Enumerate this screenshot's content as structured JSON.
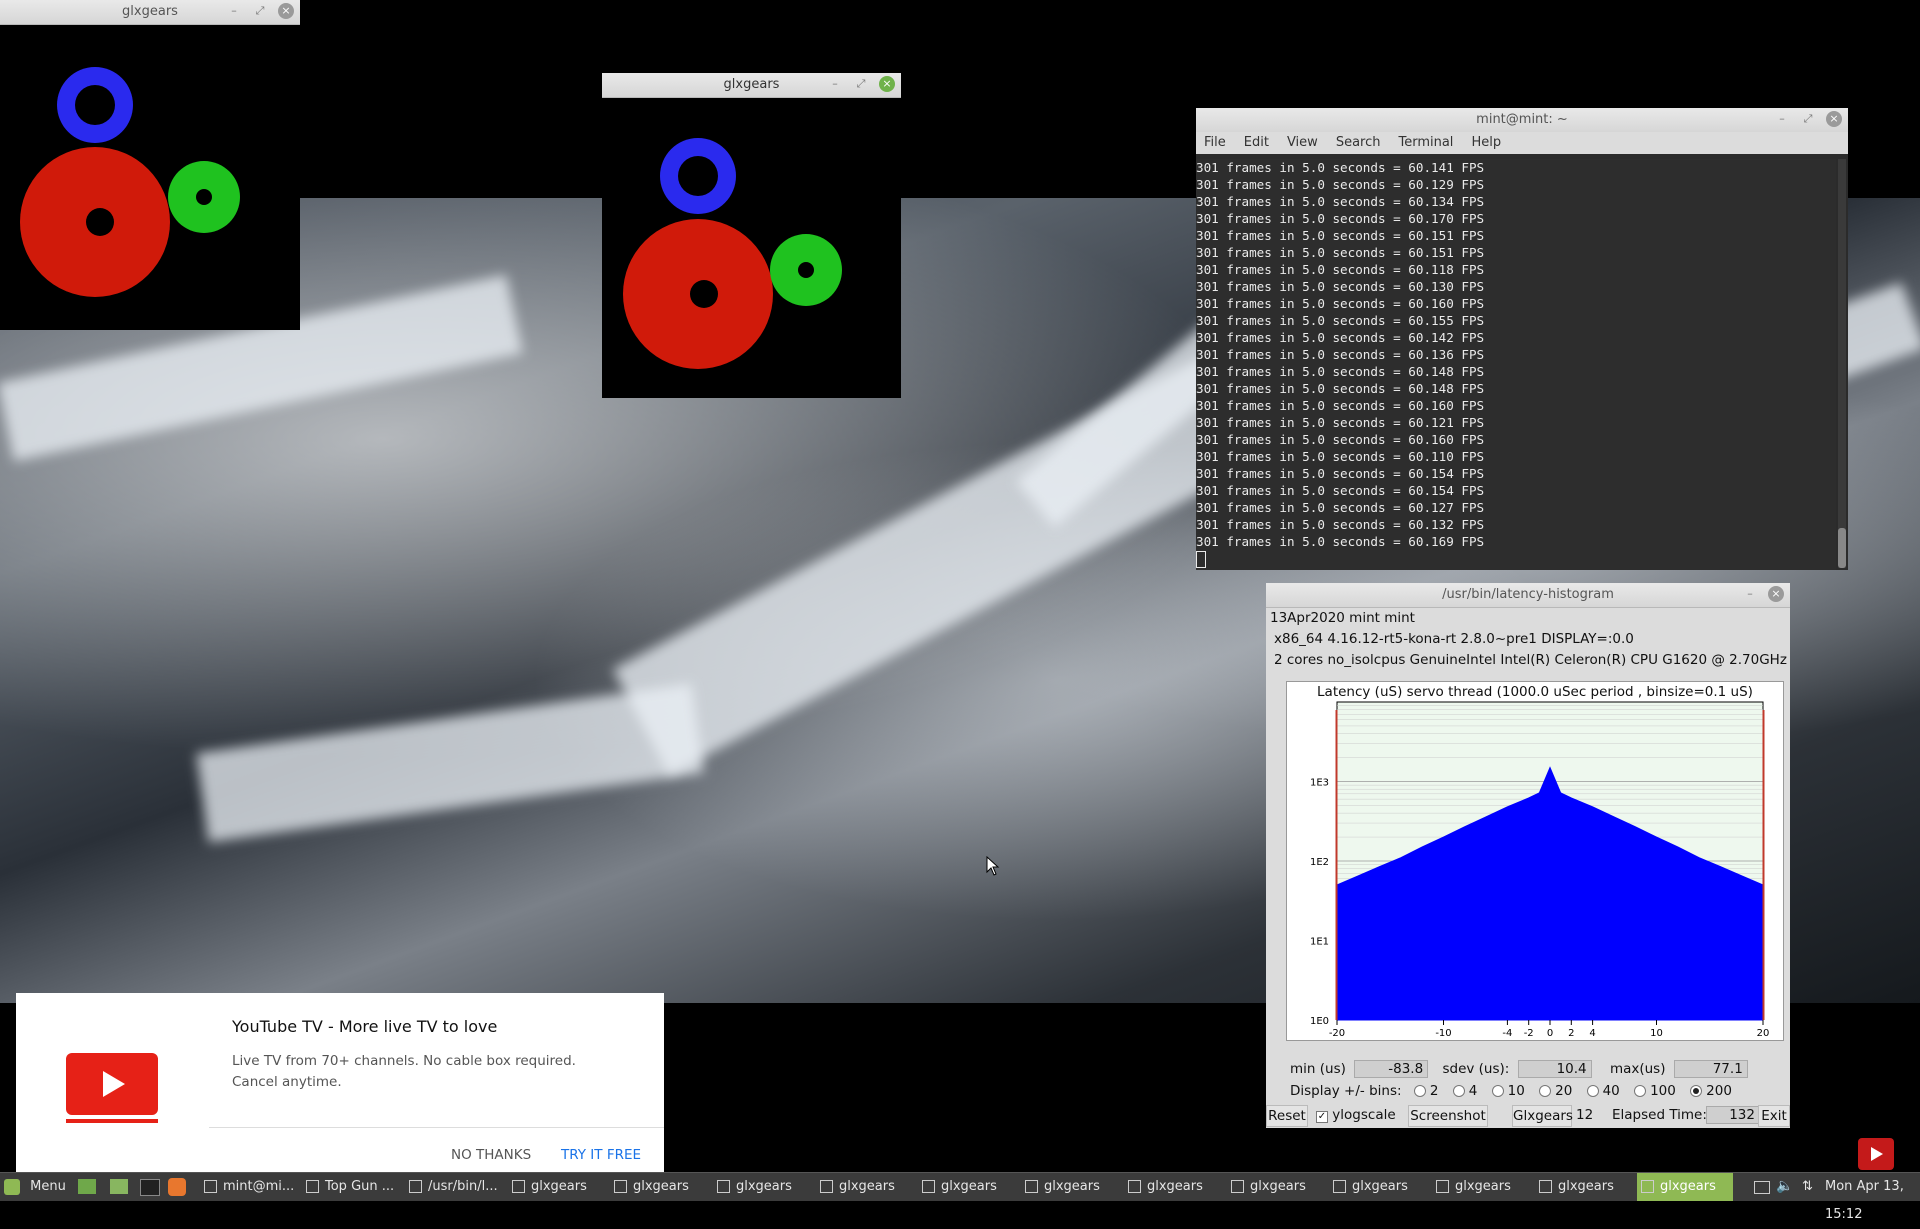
{
  "windows": {
    "glxgears_1": {
      "title": "glxgears"
    },
    "glxgears_2": {
      "title": "glxgears"
    },
    "terminal": {
      "title": "mint@mint: ~",
      "menu": [
        "File",
        "Edit",
        "View",
        "Search",
        "Terminal",
        "Help"
      ],
      "lines": [
        "301 frames in 5.0 seconds = 60.141 FPS",
        "301 frames in 5.0 seconds = 60.129 FPS",
        "301 frames in 5.0 seconds = 60.134 FPS",
        "301 frames in 5.0 seconds = 60.170 FPS",
        "301 frames in 5.0 seconds = 60.151 FPS",
        "301 frames in 5.0 seconds = 60.151 FPS",
        "301 frames in 5.0 seconds = 60.118 FPS",
        "301 frames in 5.0 seconds = 60.130 FPS",
        "301 frames in 5.0 seconds = 60.160 FPS",
        "301 frames in 5.0 seconds = 60.155 FPS",
        "301 frames in 5.0 seconds = 60.142 FPS",
        "301 frames in 5.0 seconds = 60.136 FPS",
        "301 frames in 5.0 seconds = 60.148 FPS",
        "301 frames in 5.0 seconds = 60.148 FPS",
        "301 frames in 5.0 seconds = 60.160 FPS",
        "301 frames in 5.0 seconds = 60.121 FPS",
        "301 frames in 5.0 seconds = 60.160 FPS",
        "301 frames in 5.0 seconds = 60.110 FPS",
        "301 frames in 5.0 seconds = 60.154 FPS",
        "301 frames in 5.0 seconds = 60.154 FPS",
        "301 frames in 5.0 seconds = 60.127 FPS",
        "301 frames in 5.0 seconds = 60.132 FPS",
        "301 frames in 5.0 seconds = 60.169 FPS"
      ]
    },
    "histogram": {
      "title": "/usr/bin/latency-histogram",
      "info1": "13Apr2020 mint mint",
      "info2": "x86_64  4.16.12-rt5-kona-rt  2.8.0~pre1  DISPLAY=:0.0",
      "info3": "2 cores  no_isolcpus   GenuineIntel  Intel(R) Celeron(R) CPU G1620 @ 2.70GHz",
      "plot_title": "Latency (uS) servo thread (1000.0 uSec period , binsize=0.1 uS)",
      "min_label": "min (us)",
      "min_value": "-83.8",
      "sdev_label": "sdev (us):",
      "sdev_value": "10.4",
      "max_label": "max(us)",
      "max_value": "77.1",
      "bins_label": "Display +/- bins:",
      "bins_options": [
        "2",
        "4",
        "10",
        "20",
        "40",
        "100",
        "200"
      ],
      "bins_selected": "200",
      "reset_label": "Reset",
      "ylogscale_label": "ylogscale",
      "ylogscale_checked": true,
      "screenshot_label": "Screenshot",
      "glxgears_label": "Glxgears",
      "glxgears_value": "12",
      "elapsed_label": "Elapsed Time:",
      "elapsed_value": "132",
      "exit_label": "Exit"
    }
  },
  "chart_data": {
    "type": "area",
    "title": "Latency (uS) servo thread (1000.0 uSec period , binsize=0.1 uS)",
    "xlabel": "",
    "ylabel": "",
    "x_ticks": [
      "-20",
      "-10",
      "-4",
      "-2",
      "0",
      "2",
      "4",
      "10",
      "20"
    ],
    "y_ticks": [
      "1E0",
      "1E1",
      "1E2",
      "1E3"
    ],
    "y_scale": "log",
    "xlim": [
      -20,
      20
    ],
    "ylim": [
      1,
      10000
    ],
    "series": [
      {
        "color": "#0000ff",
        "x": [
          -20,
          -18,
          -16,
          -14,
          -12,
          -10,
          -8,
          -6,
          -4,
          -2,
          -1,
          0,
          1,
          2,
          4,
          6,
          8,
          10,
          12,
          14,
          16,
          18,
          20
        ],
        "y": [
          50,
          65,
          85,
          110,
          150,
          200,
          270,
          360,
          480,
          620,
          720,
          1500,
          720,
          620,
          480,
          360,
          270,
          200,
          150,
          110,
          85,
          65,
          50
        ]
      }
    ],
    "grid": true
  },
  "youtube_popup": {
    "title": "YouTube TV - More live TV to love",
    "body": "Live TV from 70+ channels. No cable box required. Cancel anytime.",
    "no_thanks": "NO THANKS",
    "try_free": "TRY IT FREE"
  },
  "taskbar": {
    "menu_label": "Menu",
    "tasks": [
      "mint@mi...",
      "Top Gun ...",
      "/usr/bin/l...",
      "glxgears",
      "glxgears",
      "glxgears",
      "glxgears",
      "glxgears",
      "glxgears",
      "glxgears",
      "glxgears",
      "glxgears",
      "glxgears",
      "glxgears",
      "glxgears"
    ],
    "active_task": 14,
    "clock": "Mon Apr 13, 15:12"
  },
  "colors": {
    "accent": "#8fb954",
    "yt_red": "#e62117",
    "link_blue": "#1a73e8"
  }
}
